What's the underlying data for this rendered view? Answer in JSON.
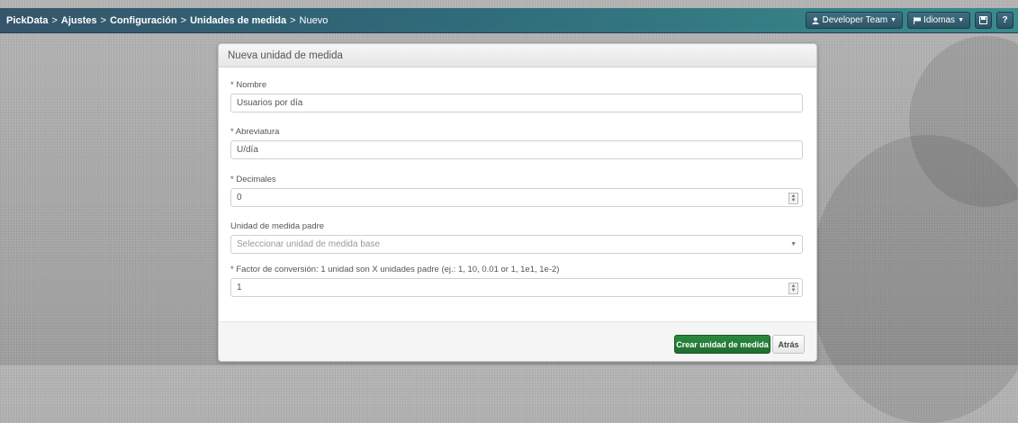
{
  "breadcrumb": {
    "items": [
      "PickData",
      "Ajustes",
      "Configuración",
      "Unidades de medida"
    ],
    "current": "Nuevo",
    "separator": ">"
  },
  "topbar": {
    "team_label": "Developer Team",
    "team_icon": "user-icon",
    "lang_label": "Idiomas",
    "lang_icon": "flag-icon",
    "save_icon": "save-icon",
    "help_label": "?"
  },
  "form": {
    "title": "Nueva unidad de medida",
    "nombre": {
      "label": "* Nombre",
      "value": "Usuarios por día"
    },
    "abreviatura": {
      "label": "* Abreviatura",
      "value": "U/día"
    },
    "decimales": {
      "label": "* Decimales",
      "value": "0"
    },
    "padre": {
      "label": "Unidad de medida padre",
      "placeholder": "Seleccionar unidad de medida base"
    },
    "factor": {
      "label": "* Factor de conversión: 1 unidad son X unidades padre (ej.: 1, 10, 0.01 or 1, 1e1, 1e-2)",
      "value": "1"
    },
    "submit_label": "Crear unidad de medida",
    "back_label": "Atrás"
  },
  "colors": {
    "topbar_start": "#36556b",
    "topbar_end": "#3a8c8c",
    "primary_button": "#2a8a3e"
  }
}
